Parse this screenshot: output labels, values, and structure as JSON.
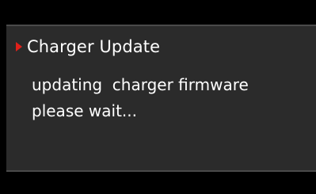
{
  "dialog": {
    "title": "Charger Update",
    "message_line1": "updating  charger firmware",
    "message_line2": "please wait...",
    "title_marker_icon": "right-triangle-icon"
  },
  "colors": {
    "background": "#000000",
    "panel": "#2b2b2b",
    "panel_border": "#4a4a4a",
    "text": "#ffffff",
    "accent_marker": "#e0201a"
  }
}
